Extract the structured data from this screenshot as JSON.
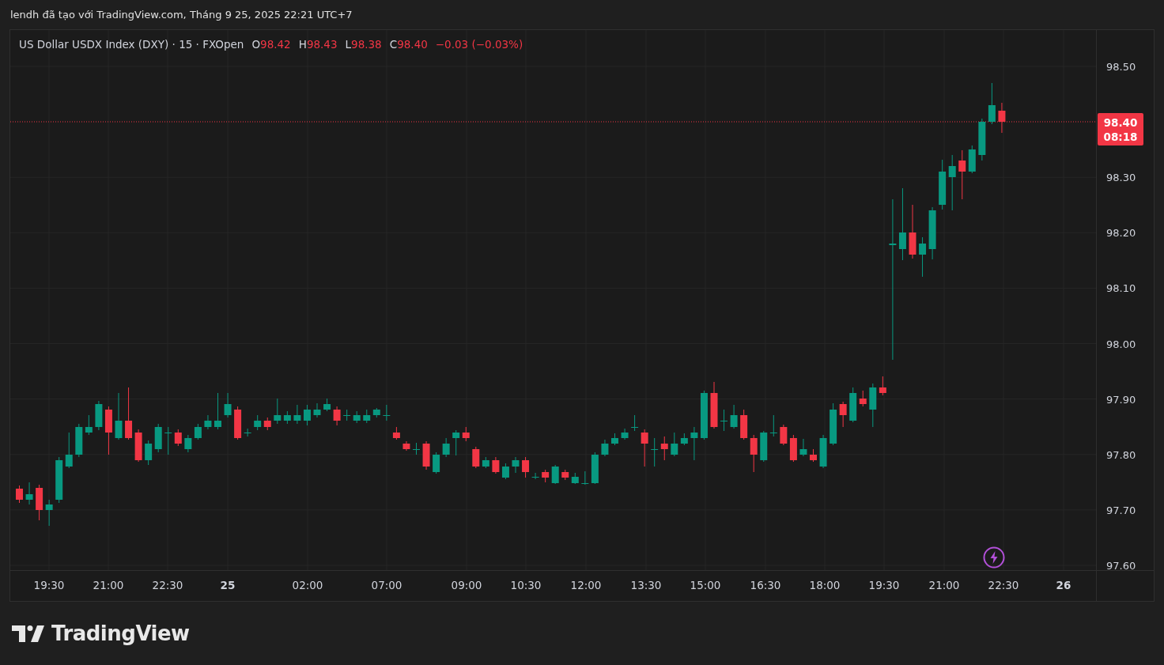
{
  "caption": "lendh đã tạo với TradingView.com, Tháng 9 25, 2025 22:21 UTC+7",
  "legend": {
    "symbol": "US Dollar USDX Index (DXY) · 15 · FXOpen",
    "ohlc": [
      {
        "label": "O",
        "value": "98.42"
      },
      {
        "label": "H",
        "value": "98.43"
      },
      {
        "label": "L",
        "value": "98.38"
      },
      {
        "label": "C",
        "value": "98.40"
      }
    ],
    "change": "−0.03 (−0.03%)"
  },
  "price_axis": {
    "ticks": [
      "98.50",
      "98.30",
      "98.20",
      "98.10",
      "98.00",
      "97.90",
      "97.80",
      "97.70",
      "97.60"
    ],
    "last_price": "98.40",
    "countdown": "08:18"
  },
  "time_axis": {
    "ticks": [
      {
        "label": "19:30",
        "bold": false
      },
      {
        "label": "21:00",
        "bold": false
      },
      {
        "label": "22:30",
        "bold": false
      },
      {
        "label": "25",
        "bold": true
      },
      {
        "label": "02:00",
        "bold": false
      },
      {
        "label": "07:00",
        "bold": false
      },
      {
        "label": "09:00",
        "bold": false
      },
      {
        "label": "10:30",
        "bold": false
      },
      {
        "label": "12:00",
        "bold": false
      },
      {
        "label": "13:30",
        "bold": false
      },
      {
        "label": "15:00",
        "bold": false
      },
      {
        "label": "16:30",
        "bold": false
      },
      {
        "label": "18:00",
        "bold": false
      },
      {
        "label": "19:30",
        "bold": false
      },
      {
        "label": "21:00",
        "bold": false
      },
      {
        "label": "22:30",
        "bold": false
      },
      {
        "label": "26",
        "bold": true
      }
    ]
  },
  "logo": {
    "text": "TradingView"
  }
}
